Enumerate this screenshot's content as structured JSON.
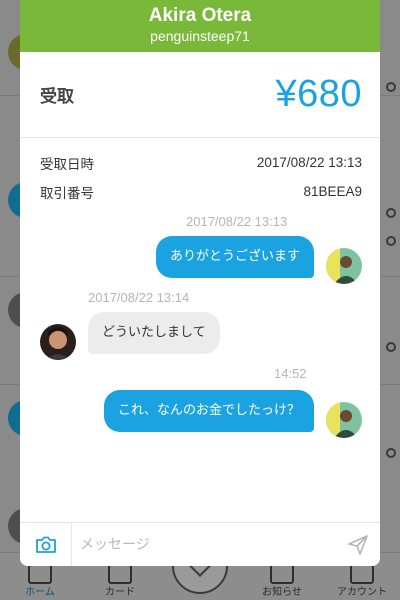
{
  "header": {
    "name": "Akira Otera",
    "user_id": "penguinsteep71"
  },
  "transaction": {
    "type_label": "受取",
    "amount": "¥680",
    "date_label": "受取日時",
    "date_value": "2017/08/22 13:13",
    "number_label": "取引番号",
    "number_value": "81BEEA9"
  },
  "messages": [
    {
      "sender": "me",
      "timestamp": "2017/08/22 13:13",
      "text": "ありがとうございます"
    },
    {
      "sender": "them",
      "timestamp": "2017/08/22 13:14",
      "text": "どういたしまして"
    },
    {
      "sender": "me",
      "timestamp": "14:52",
      "text": "これ、なんのお金でしたっけ？"
    }
  ],
  "composer": {
    "placeholder": "メッセージ",
    "camera_icon": "camera-icon",
    "send_icon": "send-icon"
  },
  "background_tabbar": {
    "tabs": [
      "ホーム",
      "カード",
      "お知らせ",
      "アカウント"
    ]
  },
  "colors": {
    "header_green": "#7ab83a",
    "accent_blue": "#1aa3e0",
    "bubble_gray": "#ececec"
  }
}
